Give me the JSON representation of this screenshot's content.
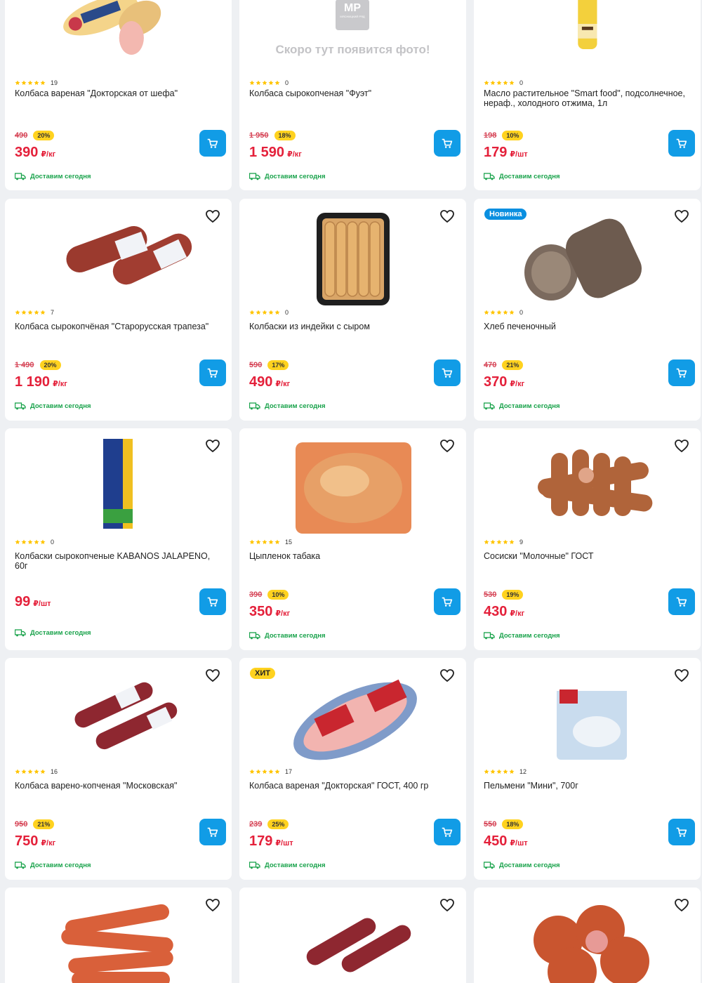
{
  "delivery_label": "Доставим сегодня",
  "placeholder_logo": "МР",
  "placeholder_logo_sub": "МЯСНИЦКИЙ РЯД",
  "placeholder_text": "Скоро тут появится фото!",
  "colors": {
    "accent": "#119ce6",
    "price": "#e4203a",
    "discount_bg": "#ffd21f",
    "delivery": "#18a24a",
    "new_badge": "#0a8fe0"
  },
  "products": [
    {
      "title": "Колбаса вареная \"Докторская от шефа\"",
      "rating_count": "19",
      "old_price": "490",
      "discount": "20%",
      "price": "390",
      "unit": "₽/кг",
      "image": "doctor-sausage-chef"
    },
    {
      "title": "Колбаса сырокопченая \"Фуэт\"",
      "rating_count": "0",
      "old_price": "1 950",
      "discount": "18%",
      "price": "1 590",
      "unit": "₽/кг",
      "image": "placeholder"
    },
    {
      "title": "Масло растительное \"Smart food\", подсолнечное, нераф., холодного отжима, 1л",
      "rating_count": "0",
      "old_price": "198",
      "discount": "10%",
      "price": "179",
      "unit": "₽/шт",
      "image": "oil-bottle"
    },
    {
      "title": "Колбаса сырокопчёная \"Старорусская трапеза\"",
      "rating_count": "7",
      "old_price": "1 490",
      "discount": "20%",
      "price": "1 190",
      "unit": "₽/кг",
      "image": "salami"
    },
    {
      "title": "Колбаски из индейки с сыром",
      "rating_count": "0",
      "old_price": "590",
      "discount": "17%",
      "price": "490",
      "unit": "₽/кг",
      "image": "turkey-sausages-tray"
    },
    {
      "title": "Хлеб печеночный",
      "rating_count": "0",
      "old_price": "470",
      "discount": "21%",
      "price": "370",
      "unit": "₽/кг",
      "image": "liver-bread",
      "badge": "Новинка",
      "badge_type": "new"
    },
    {
      "title": "Колбаски сырокопченые KABANOS JALAPENO, 60г",
      "rating_count": "0",
      "old_price": "",
      "discount": "",
      "price": "99",
      "unit": "₽/шт",
      "image": "kabanos-pack"
    },
    {
      "title": "Цыпленок табака",
      "rating_count": "15",
      "old_price": "390",
      "discount": "10%",
      "price": "350",
      "unit": "₽/кг",
      "image": "chicken-pack"
    },
    {
      "title": "Сосиски \"Молочные\" ГОСТ",
      "rating_count": "9",
      "old_price": "530",
      "discount": "19%",
      "price": "430",
      "unit": "₽/кг",
      "image": "milk-sausages"
    },
    {
      "title": "Колбаса варено-копченая \"Московская\"",
      "rating_count": "16",
      "old_price": "950",
      "discount": "21%",
      "price": "750",
      "unit": "₽/кг",
      "image": "moscow-sausage"
    },
    {
      "title": "Колбаса вареная \"Докторская\" ГОСТ, 400 гр",
      "rating_count": "17",
      "old_price": "239",
      "discount": "25%",
      "price": "179",
      "unit": "₽/шт",
      "image": "doctor-gost",
      "badge": "ХИТ",
      "badge_type": "hit"
    },
    {
      "title": "Пельмени \"Мини\", 700г",
      "rating_count": "12",
      "old_price": "550",
      "discount": "18%",
      "price": "450",
      "unit": "₽/шт",
      "image": "pelmeni-pack"
    },
    {
      "title": "",
      "rating_count": "",
      "old_price": "",
      "discount": "",
      "price": "",
      "unit": "",
      "image": "sausages-red"
    },
    {
      "title": "",
      "rating_count": "",
      "old_price": "",
      "discount": "",
      "price": "",
      "unit": "",
      "image": "salami-2"
    },
    {
      "title": "",
      "rating_count": "",
      "old_price": "",
      "discount": "",
      "price": "",
      "unit": "",
      "image": "sausages-thick"
    }
  ]
}
